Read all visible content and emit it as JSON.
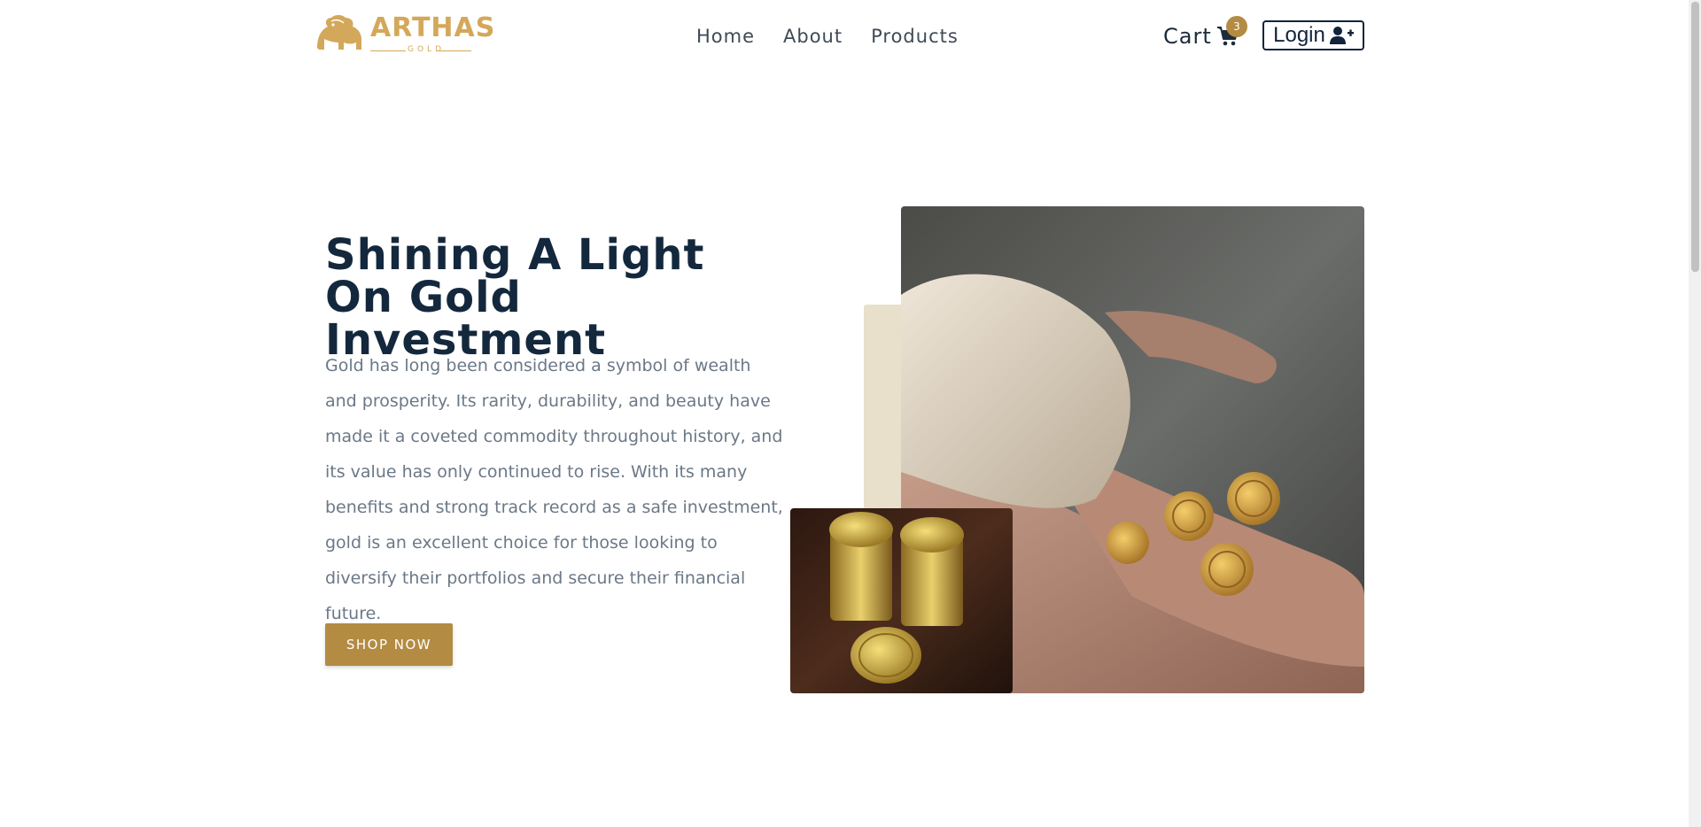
{
  "logo": {
    "brand": "ARTHAS",
    "sub": "GOLD",
    "icon": "lion-icon",
    "color": "#d4a85a"
  },
  "nav": {
    "items": [
      {
        "label": "Home"
      },
      {
        "label": "About"
      },
      {
        "label": "Products"
      }
    ]
  },
  "cart": {
    "label": "Cart",
    "count": "3",
    "icon": "shopping-cart-icon"
  },
  "login": {
    "label": "Login",
    "icon": "user-plus-icon"
  },
  "hero": {
    "title_line1": "Shining A Light",
    "title_line2": "On Gold Investment",
    "text": "Gold has long been considered a symbol of wealth and prosperity. Its rarity, durability, and beauty have made it a coveted commodity throughout history, and its value has only continued to rise. With its many benefits and strong track record as a safe investment, gold is an excellent choice for those looking to diversify their portfolios and secure their financial future.",
    "button_label": "SHOP NOW"
  },
  "colors": {
    "accent": "#b38b42",
    "heading": "#14283d",
    "body_text": "#6b7887",
    "accent_block": "#e9e0cb"
  }
}
